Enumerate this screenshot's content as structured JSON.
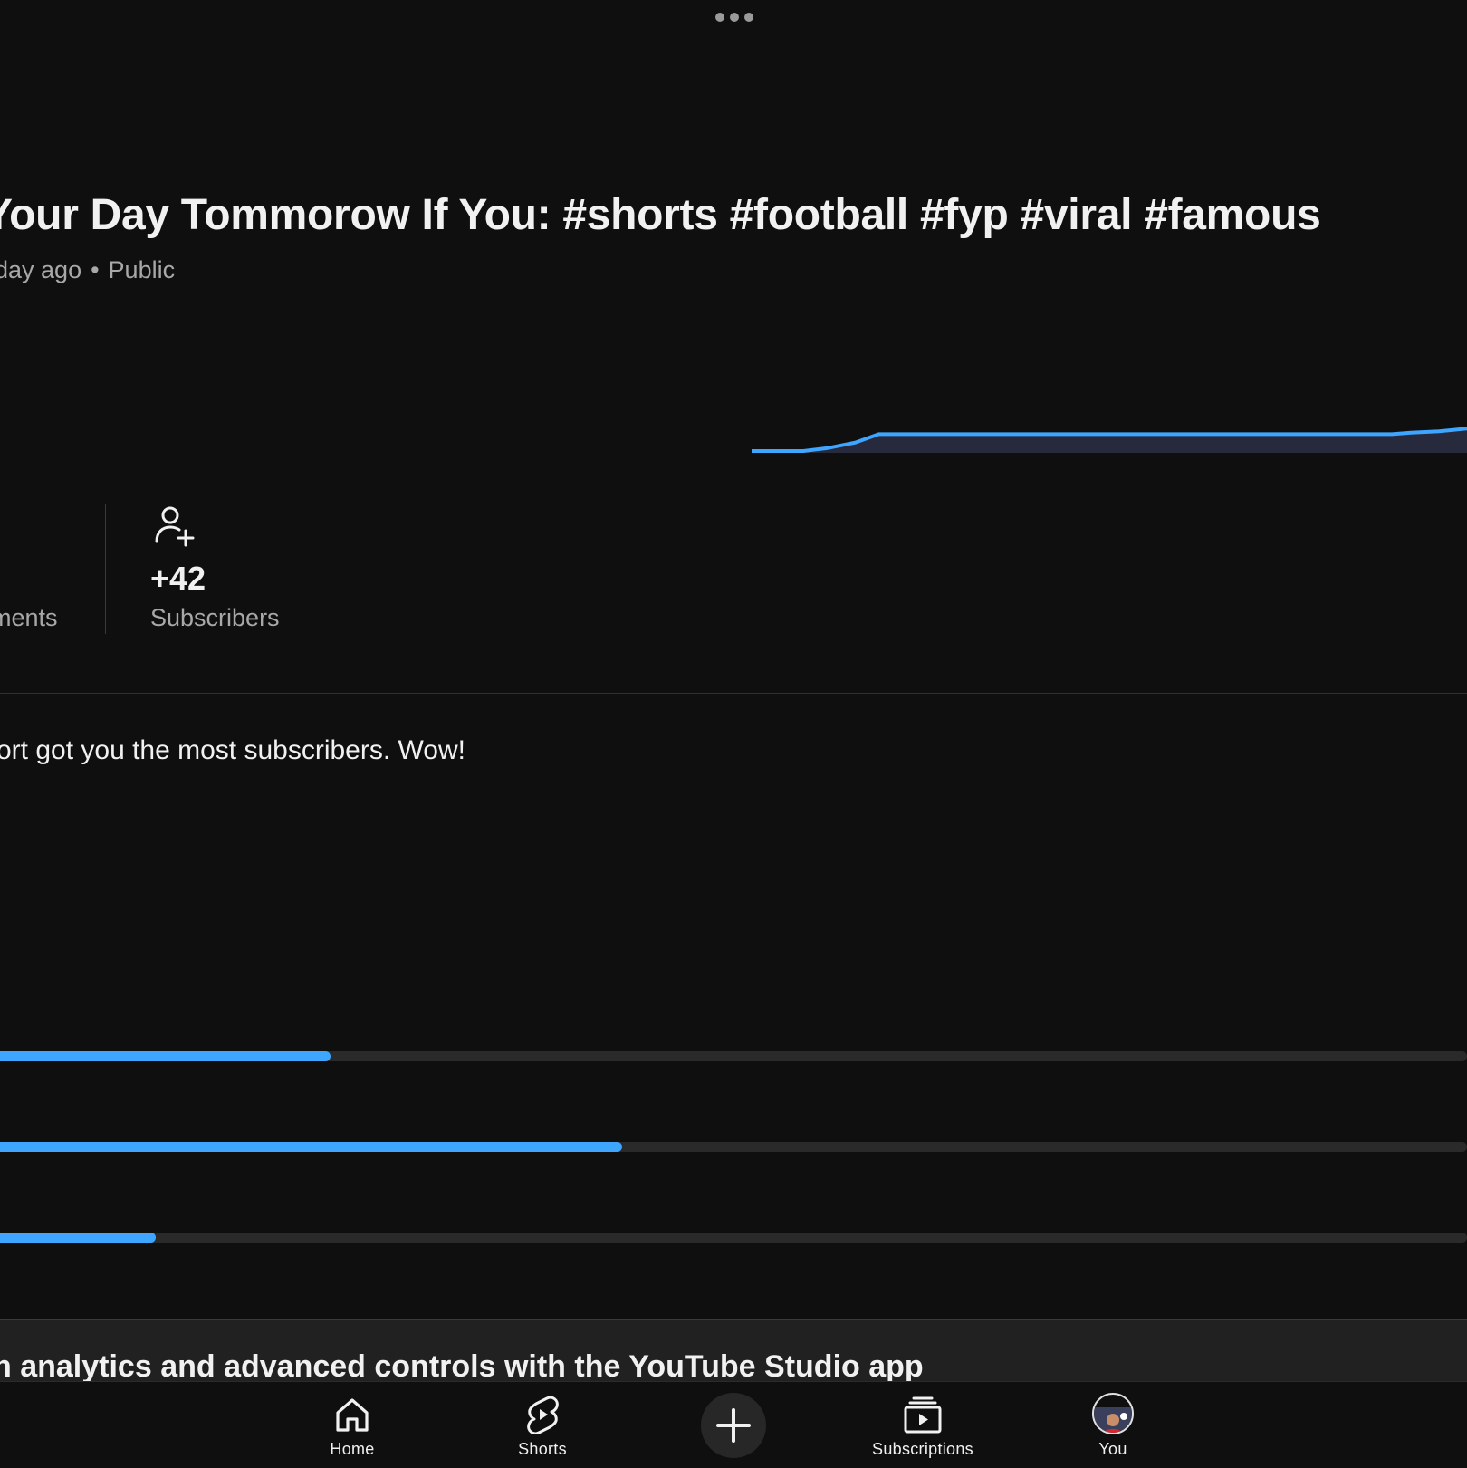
{
  "header": {
    "more_icon": "more-horizontal-icon"
  },
  "video": {
    "title": "Your Day Tommorow If You: #shorts #football #fyp #viral #famous",
    "time_ago": "day ago",
    "separator": "•",
    "visibility": "Public"
  },
  "chart_data": {
    "type": "area",
    "x": [
      0,
      55,
      80,
      110,
      135,
      160,
      200,
      300,
      400,
      500,
      600,
      680,
      700,
      730,
      760
    ],
    "values": [
      0,
      0,
      1,
      3,
      6,
      6,
      6,
      6,
      6,
      6,
      6,
      6,
      6.5,
      7,
      8
    ],
    "grid": false,
    "colors": {
      "line": "#3ea6ff",
      "fill": "#272a3c"
    }
  },
  "stats": {
    "left_label": "ments",
    "subscribers": {
      "icon": "person-add-icon",
      "value": "+42",
      "label": "Subscribers"
    }
  },
  "insight": {
    "text": "ort got you the most subscribers. Wow!"
  },
  "progress_bars": [
    {
      "fraction": 0.225
    },
    {
      "fraction": 0.424
    },
    {
      "fraction": 0.106
    }
  ],
  "promo": {
    "text": "n analytics and advanced controls with the YouTube Studio app"
  },
  "nav": {
    "home": {
      "label": "Home",
      "icon": "home-icon"
    },
    "shorts": {
      "label": "Shorts",
      "icon": "shorts-icon"
    },
    "create": {
      "icon": "plus-icon"
    },
    "subscriptions": {
      "label": "Subscriptions",
      "icon": "subscriptions-icon"
    },
    "you": {
      "label": "You",
      "icon": "avatar"
    }
  },
  "colors": {
    "background": "#0f0f10",
    "accent": "#3ea6ff",
    "muted_text": "#a8a8a8"
  }
}
